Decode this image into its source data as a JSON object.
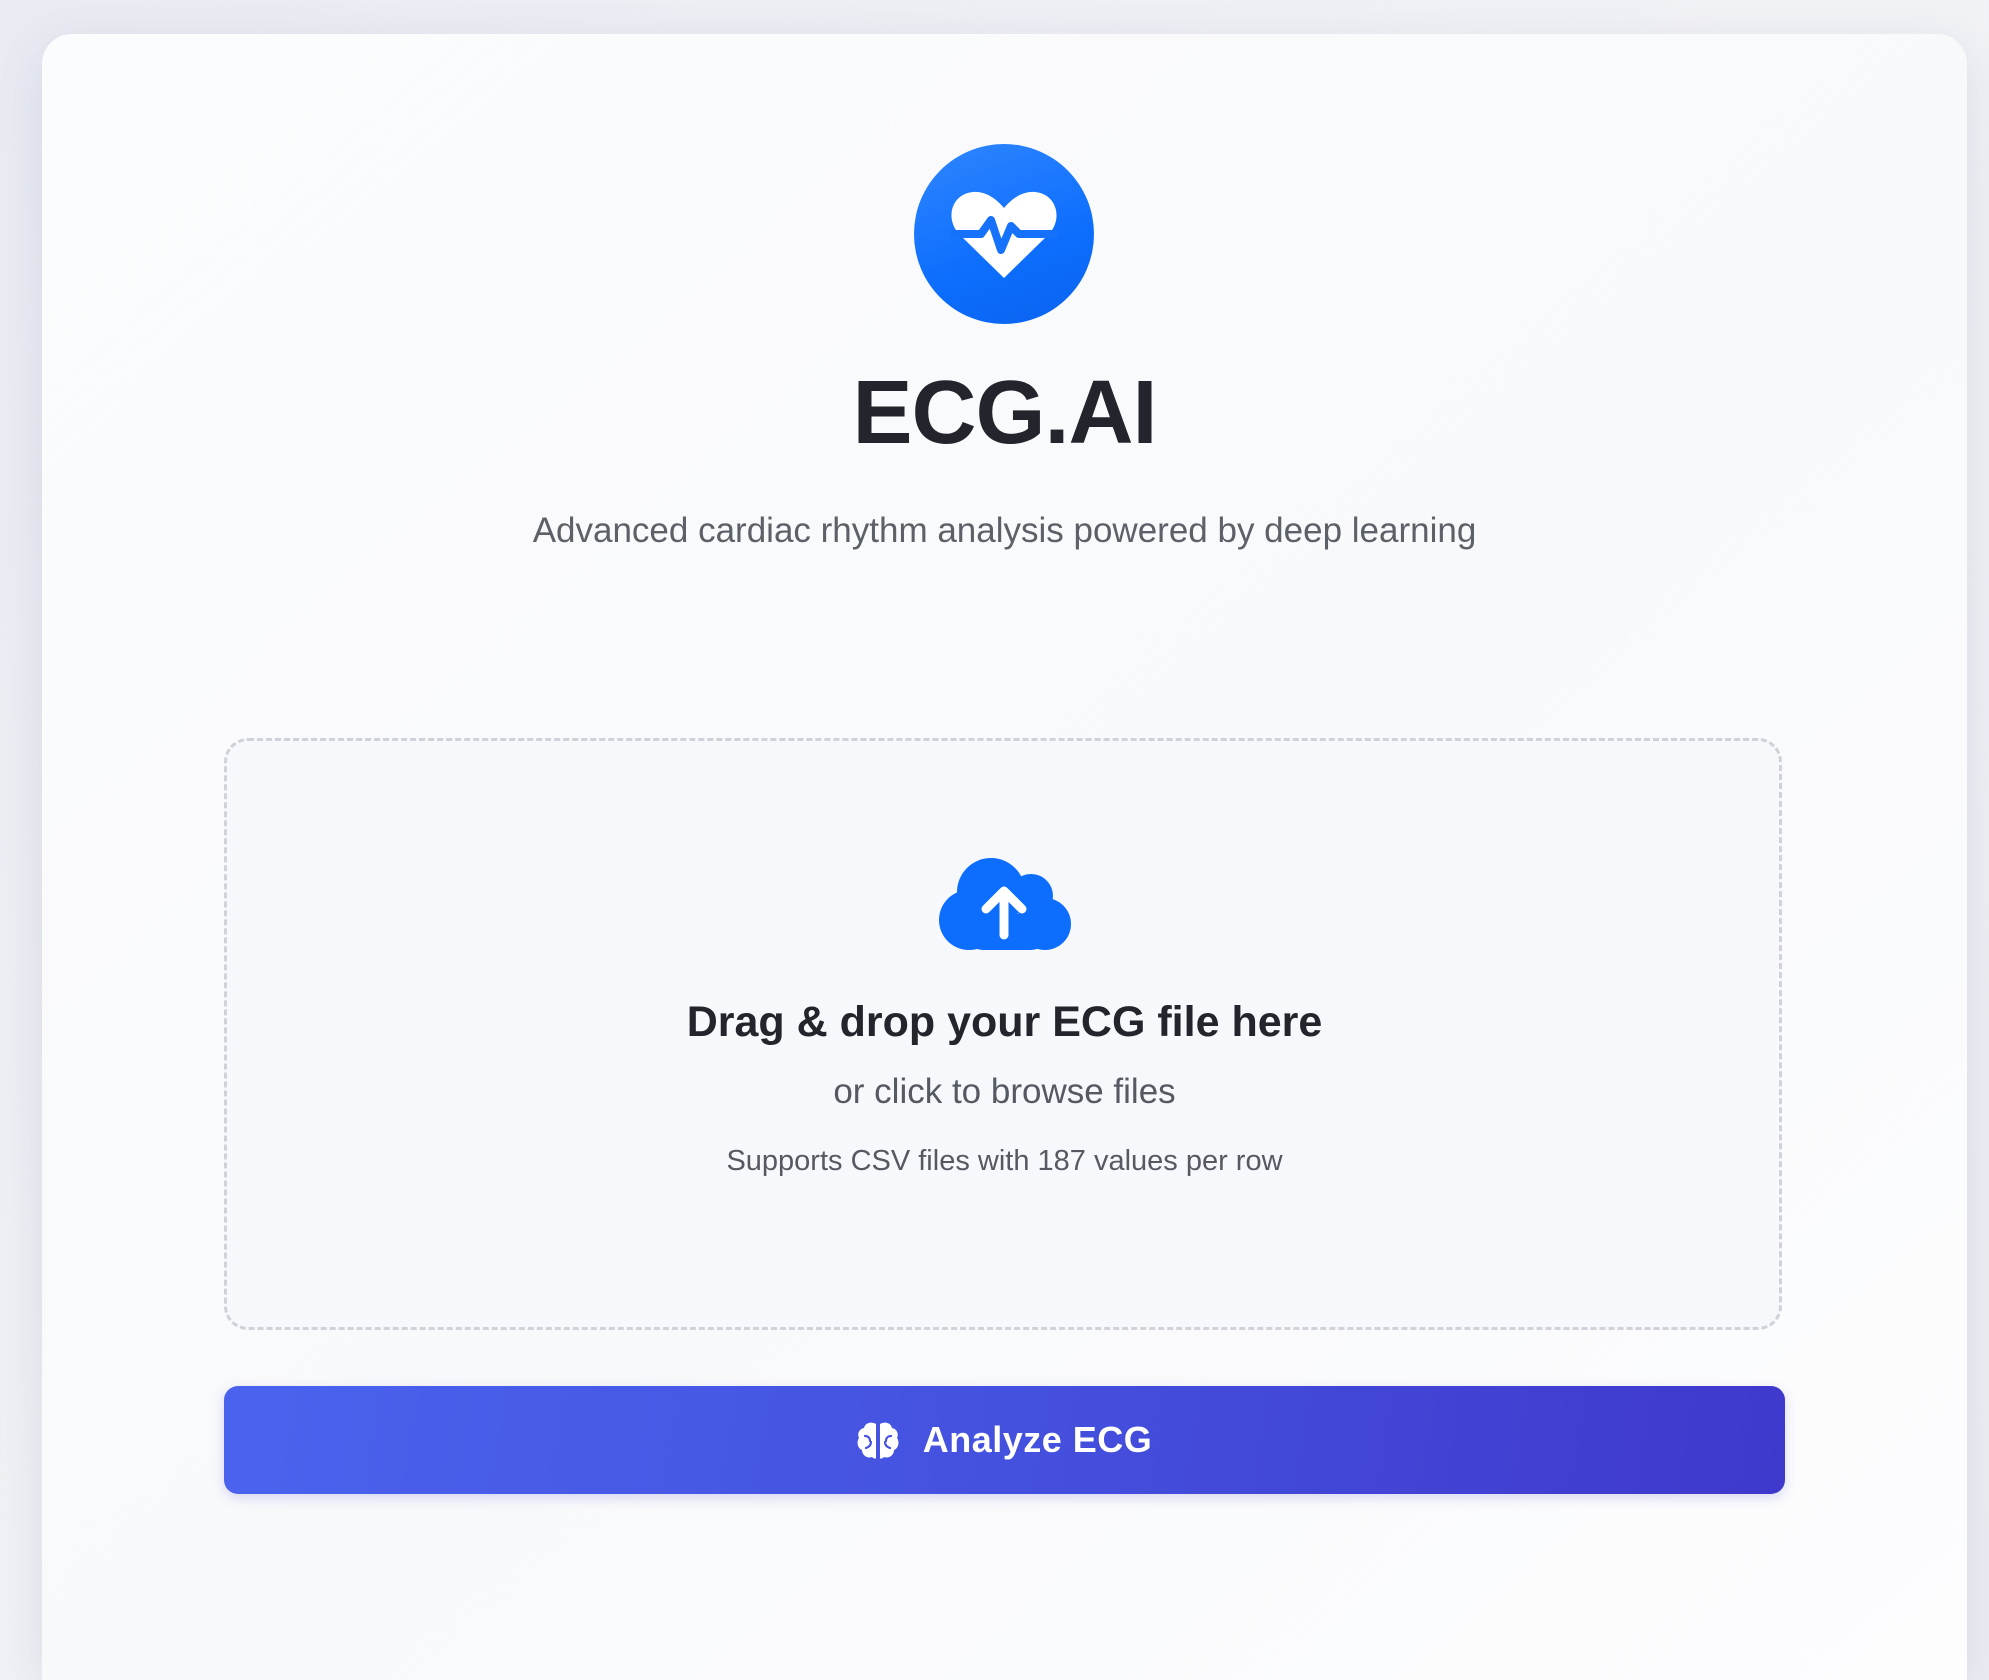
{
  "app": {
    "title": "ECG.AI",
    "subtitle": "Advanced cardiac rhythm analysis powered by deep learning",
    "logo_icon": "heart-pulse-icon",
    "accent_color": "#0d6efd"
  },
  "upload": {
    "icon": "cloud-upload-icon",
    "title": "Drag & drop your ECG file here",
    "browse_text": "or click to browse files",
    "hint": "Supports CSV files with 187 values per row"
  },
  "actions": {
    "analyze_label": "Analyze ECG",
    "analyze_icon": "brain-icon",
    "button_gradient": [
      "#4a63ee",
      "#3f38cc"
    ]
  }
}
